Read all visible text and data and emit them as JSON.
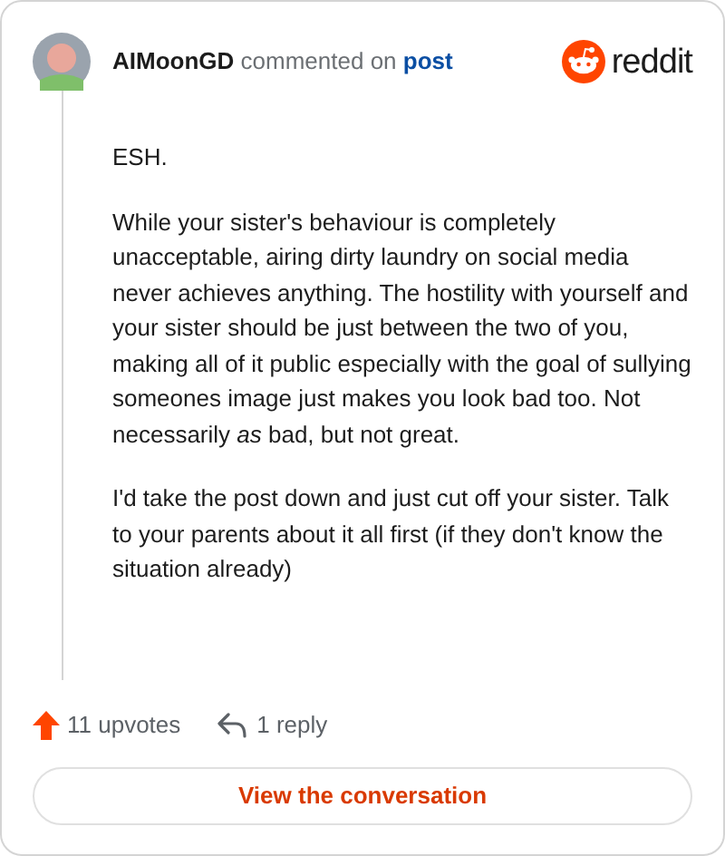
{
  "comment": {
    "author": "AIMoonGD",
    "action": "commented on",
    "link": "post",
    "paragraphs": [
      "ESH.",
      "While your sister's behaviour is completely unacceptable, airing dirty laundry on social media never achieves anything. The hostility with yourself and your sister should be just between the two of you, making all of it public especially with the goal of sullying someones image just makes you look bad too. Not necessarily *as* bad, but not great.",
      "I'd take the post down and just cut off your sister. Talk to your parents about it all first (if they don't know the situation already)"
    ],
    "upvotes": "11 upvotes",
    "replies": "1 reply"
  },
  "brand": "reddit",
  "button": "View the conversation"
}
